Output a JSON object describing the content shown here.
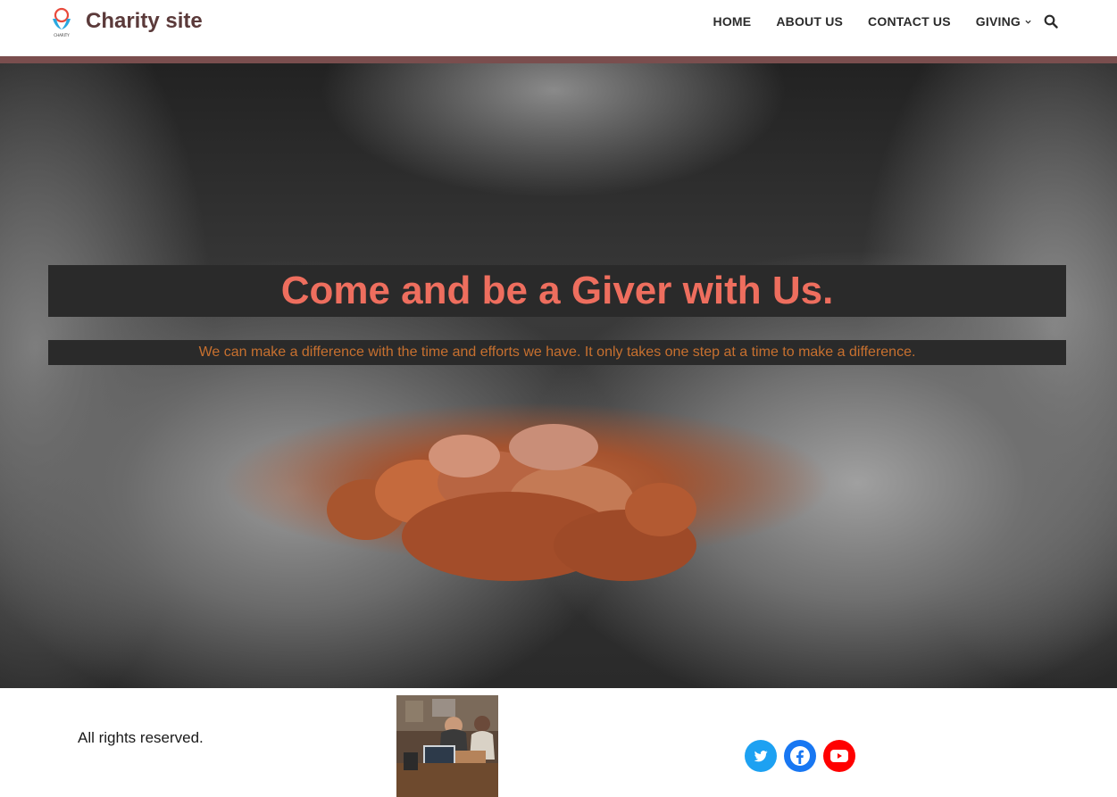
{
  "header": {
    "site_title": "Charity site",
    "logo_text": "CHARITY",
    "nav": [
      {
        "label": "HOME"
      },
      {
        "label": "ABOUT US"
      },
      {
        "label": "CONTACT US"
      },
      {
        "label": "GIVING",
        "has_dropdown": true
      }
    ],
    "search_icon": "search-icon"
  },
  "hero": {
    "heading": "Come and be a Giver with Us.",
    "subheading": "We can make a difference with the time and efforts we have. It only takes one step at a time to make a difference."
  },
  "footer": {
    "rights": "All rights reserved.",
    "social": [
      "twitter-icon",
      "facebook-icon",
      "youtube-icon"
    ]
  },
  "colors": {
    "site_title": "#5b3a3a",
    "accent_bar": "#7a4e4e",
    "hero_heading": "#ee6e5e",
    "hero_subheading": "#c7702f",
    "twitter": "#1da1f2",
    "facebook": "#1877f2",
    "youtube": "#ff0000"
  }
}
